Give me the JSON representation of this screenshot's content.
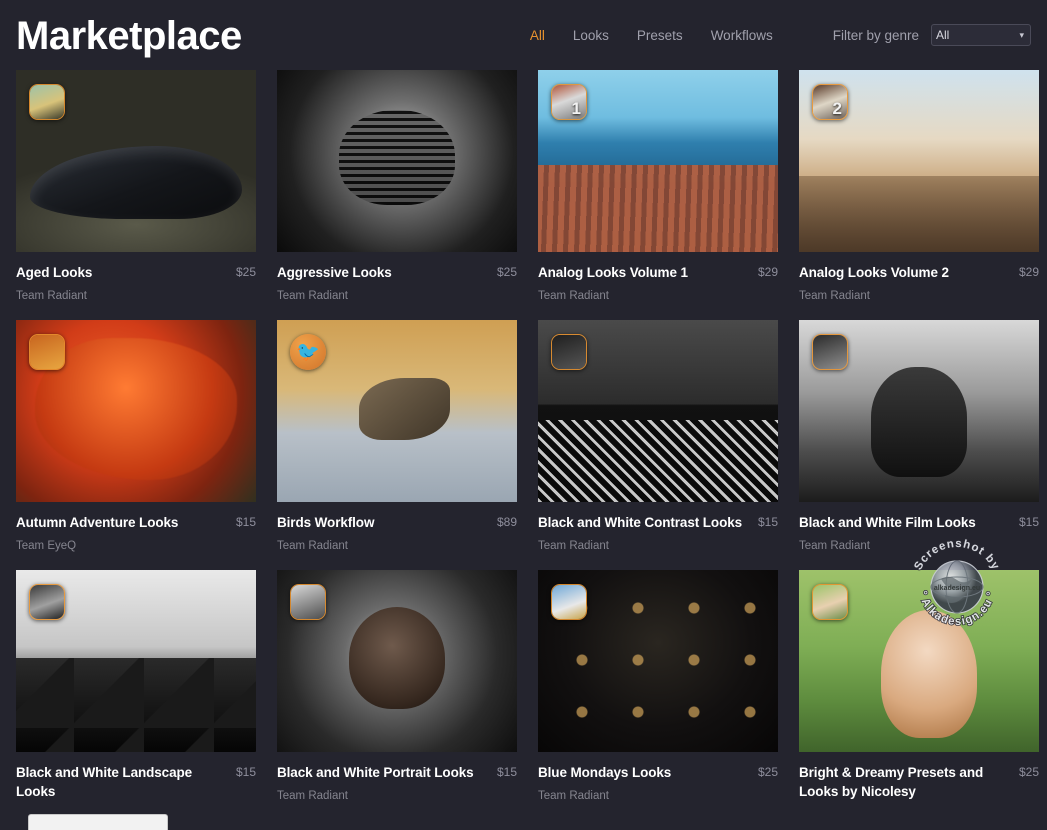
{
  "header": {
    "title": "Marketplace",
    "nav": [
      {
        "label": "All",
        "active": true
      },
      {
        "label": "Looks",
        "active": false
      },
      {
        "label": "Presets",
        "active": false
      },
      {
        "label": "Workflows",
        "active": false
      }
    ],
    "filter_label": "Filter by genre",
    "genre_select": {
      "value": "All",
      "chevron": "chevron-down-icon"
    },
    "accent_color": "#e8922f"
  },
  "cards": [
    {
      "title": "Aged Looks",
      "price": "$25",
      "author": "Team Radiant",
      "badge_kind": "thumb",
      "badge_text": "",
      "art": "art-car"
    },
    {
      "title": "Aggressive Looks",
      "price": "$25",
      "author": "Team Radiant",
      "badge_kind": "none",
      "badge_text": "",
      "art": "art-hockey"
    },
    {
      "title": "Analog Looks Volume 1",
      "price": "$29",
      "author": "Team Radiant",
      "badge_kind": "number",
      "badge_text": "1",
      "art": "art-coast"
    },
    {
      "title": "Analog Looks Volume 2",
      "price": "$29",
      "author": "Team Radiant",
      "badge_kind": "number",
      "badge_text": "2",
      "art": "art-bridge"
    },
    {
      "title": "Autumn Adventure Looks",
      "price": "$15",
      "author": "Team EyeQ",
      "badge_kind": "thumb",
      "badge_text": "",
      "art": "art-autumn"
    },
    {
      "title": "Birds Workflow",
      "price": "$89",
      "author": "Team Radiant",
      "badge_kind": "round",
      "badge_text": "ὂ6",
      "art": "art-bird"
    },
    {
      "title": "Black and White Contrast Looks",
      "price": "$15",
      "author": "Team Radiant",
      "badge_kind": "thumb",
      "badge_text": "",
      "art": "art-bw-contrast"
    },
    {
      "title": "Black and White Film Looks",
      "price": "$15",
      "author": "Team Radiant",
      "badge_kind": "thumb",
      "badge_text": "",
      "art": "art-bw-film"
    },
    {
      "title": "Black and White Landscape Looks",
      "price": "$15",
      "author": "",
      "badge_kind": "thumb",
      "badge_text": "",
      "art": "art-bw-landscape"
    },
    {
      "title": "Black and White Portrait Looks",
      "price": "$15",
      "author": "Team Radiant",
      "badge_kind": "thumb",
      "badge_text": "",
      "art": "art-bw-portrait"
    },
    {
      "title": "Blue Mondays Looks",
      "price": "$25",
      "author": "Team Radiant",
      "badge_kind": "thumb",
      "badge_text": "",
      "art": "art-dj"
    },
    {
      "title": "Bright & Dreamy Presets and Looks by Nicolesy",
      "price": "$25",
      "author": "",
      "badge_kind": "thumb",
      "badge_text": "",
      "art": "art-child"
    }
  ],
  "watermark": {
    "line_top": "Screenshot by",
    "line_bottom": "Alkadesign.eu",
    "center": "alkadesign.eu"
  }
}
